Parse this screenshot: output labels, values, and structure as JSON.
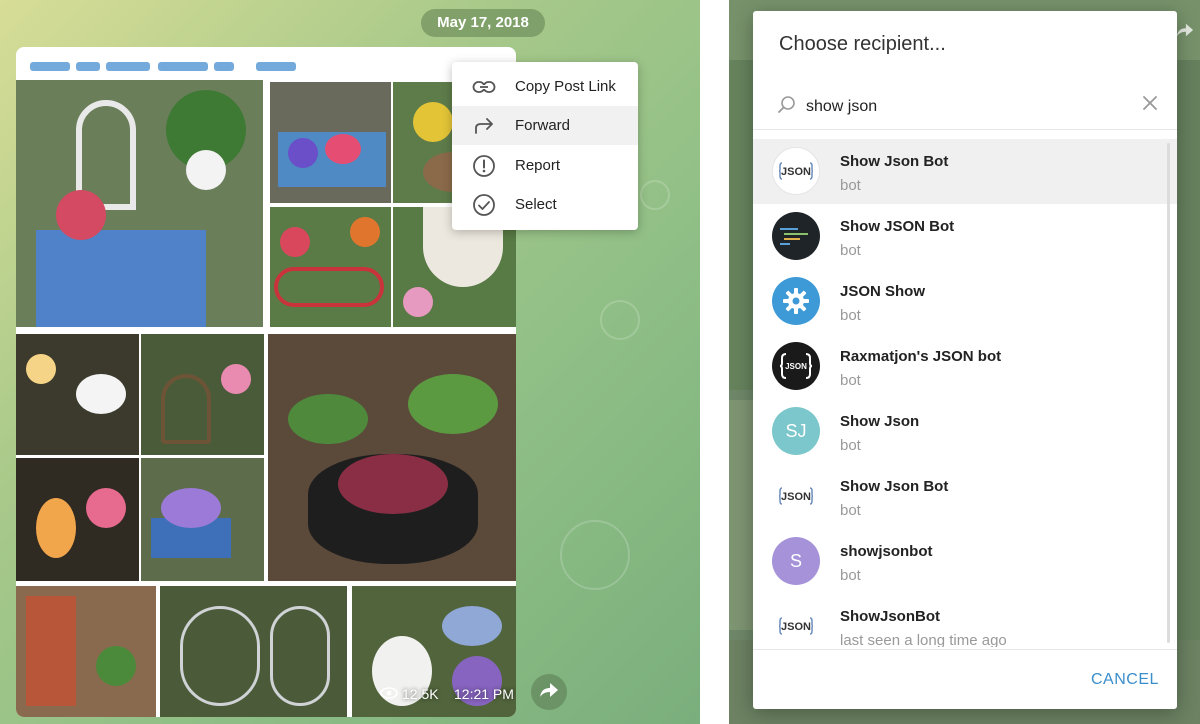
{
  "chat": {
    "date": "May 17, 2018",
    "views": "12.5K",
    "time": "12:21 PM"
  },
  "context_menu": {
    "items": [
      {
        "label": "Copy Post Link",
        "icon": "link-icon"
      },
      {
        "label": "Forward",
        "icon": "forward-arrow-icon"
      },
      {
        "label": "Report",
        "icon": "report-icon"
      },
      {
        "label": "Select",
        "icon": "check-circle-icon"
      }
    ]
  },
  "dialog": {
    "title": "Choose recipient...",
    "search_value": "show json",
    "cancel_label": "CANCEL",
    "results": [
      {
        "name": "Show Json Bot",
        "subtitle": "bot",
        "avatar": "json-logo",
        "highlighted": true
      },
      {
        "name": "Show JSON Bot",
        "subtitle": "bot",
        "avatar": "dark-code"
      },
      {
        "name": "JSON Show",
        "subtitle": "bot",
        "avatar": "blue-gear"
      },
      {
        "name": "Raxmatjon's JSON bot",
        "subtitle": "bot",
        "avatar": "json-braces"
      },
      {
        "name": "Show Json",
        "subtitle": "bot",
        "avatar": "initials",
        "initials": "SJ",
        "color": "#7cc7cc"
      },
      {
        "name": "Show Json Bot",
        "subtitle": "bot",
        "avatar": "json-logo"
      },
      {
        "name": "showjsonbot",
        "subtitle": "bot",
        "avatar": "initials",
        "initials": "S",
        "color": "#a592d8"
      },
      {
        "name": "ShowJsonBot",
        "subtitle": "last seen a long time ago",
        "avatar": "json-logo"
      }
    ]
  },
  "colors": {
    "accent": "#3a8ecc",
    "date_pill": "#6d8a5a",
    "highlight": "#f0f0f0"
  }
}
